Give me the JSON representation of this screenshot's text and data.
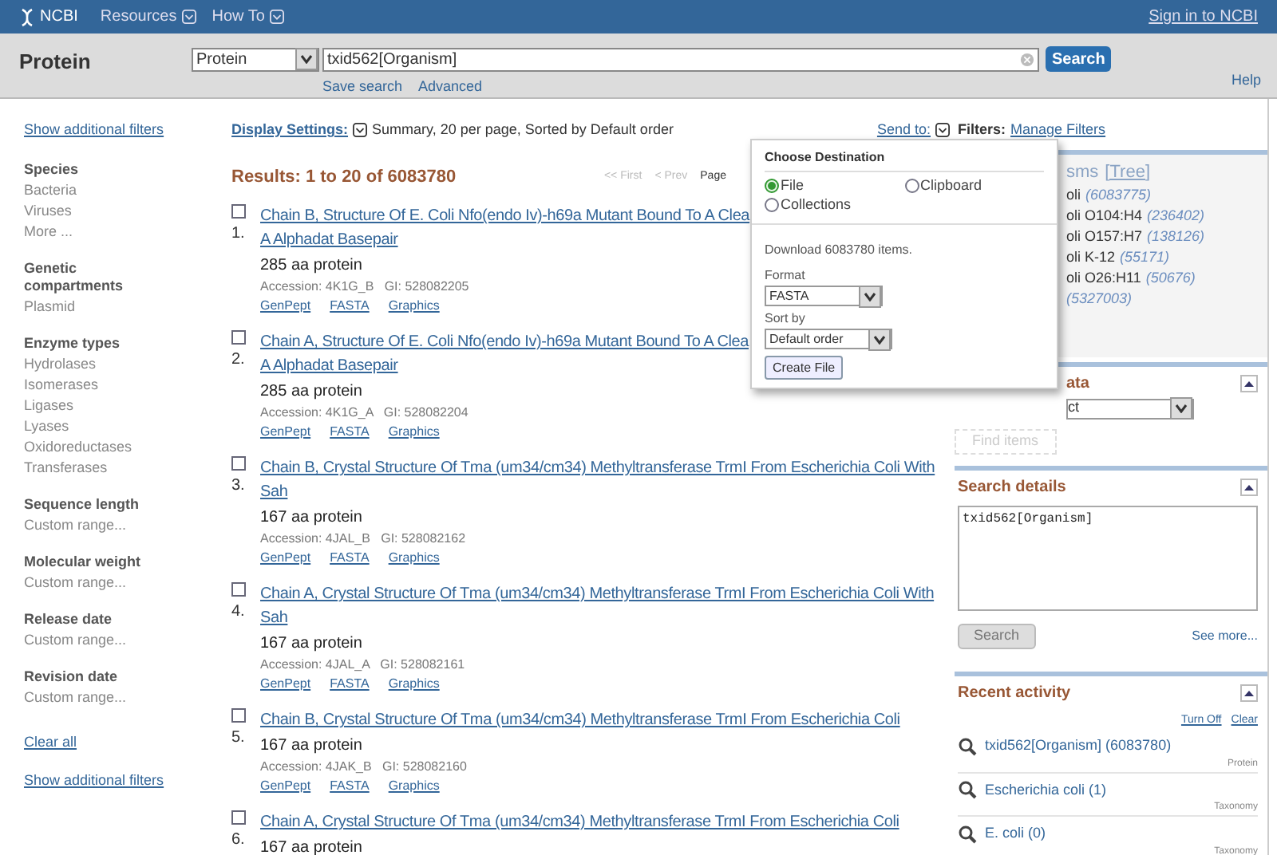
{
  "header": {
    "logo": "NCBI",
    "menus": [
      "Resources",
      "How To"
    ],
    "sign_in": "Sign in to NCBI"
  },
  "search_bar": {
    "title": "Protein",
    "database": "Protein",
    "query": "txid562[Organism]",
    "button": "Search",
    "links": [
      "Save search",
      "Advanced"
    ],
    "help": "Help"
  },
  "filters": {
    "show_link_top": "Show additional filters",
    "groups": [
      {
        "title": "Species",
        "items": [
          "Bacteria",
          "Viruses",
          "More ..."
        ]
      },
      {
        "title": "Genetic compartments",
        "items": [
          "Plasmid"
        ]
      },
      {
        "title": "Enzyme types",
        "items": [
          "Hydrolases",
          "Isomerases",
          "Ligases",
          "Lyases",
          "Oxidoreductases",
          "Transferases"
        ]
      },
      {
        "title": "Sequence length",
        "items": [
          "Custom range..."
        ]
      },
      {
        "title": "Molecular weight",
        "items": [
          "Custom range..."
        ]
      },
      {
        "title": "Release date",
        "items": [
          "Custom range..."
        ]
      },
      {
        "title": "Revision date",
        "items": [
          "Custom range..."
        ]
      }
    ],
    "clear": "Clear all",
    "show_link_bottom": "Show additional filters"
  },
  "toolbar": {
    "display_settings": "Display Settings:",
    "summary": "Summary, 20 per page, Sorted by Default order",
    "send_to": "Send to:",
    "filters_label": "Filters:",
    "manage_filters": "Manage Filters"
  },
  "results": {
    "heading": "Results: 1 to 20 of 6083780",
    "pager": [
      "<< First",
      "< Prev",
      "Page"
    ],
    "items": [
      {
        "number": "1.",
        "checked": false,
        "title_lines": [
          "Chain B, Structure Of E. Coli Nfo(endo Iv)-h69a Mutant Bound To A Clea",
          "A Alphadat Basepair"
        ],
        "length": "285 aa protein",
        "accession": "Accession: 4K1G_B   GI: 528082205",
        "links": [
          "GenPept",
          "FASTA",
          "Graphics"
        ]
      },
      {
        "number": "2.",
        "checked": false,
        "title_lines": [
          "Chain A, Structure Of E. Coli Nfo(endo Iv)-h69a Mutant Bound To A Clea",
          "A Alphadat Basepair"
        ],
        "length": "285 aa protein",
        "accession": "Accession: 4K1G_A   GI: 528082204",
        "links": [
          "GenPept",
          "FASTA",
          "Graphics"
        ]
      },
      {
        "number": "3.",
        "checked": false,
        "title_lines": [
          "Chain B, Crystal Structure Of Tma (um34/cm34) Methyltransferase TrmI From Escherichia Coli With",
          "Sah"
        ],
        "length": "167 aa protein",
        "accession": "Accession: 4JAL_B   GI: 528082162",
        "links": [
          "GenPept",
          "FASTA",
          "Graphics"
        ]
      },
      {
        "number": "4.",
        "checked": false,
        "title_lines": [
          "Chain A, Crystal Structure Of Tma (um34/cm34) Methyltransferase TrmI From Escherichia Coli With",
          "Sah"
        ],
        "length": "167 aa protein",
        "accession": "Accession: 4JAL_A   GI: 528082161",
        "links": [
          "GenPept",
          "FASTA",
          "Graphics"
        ]
      },
      {
        "number": "5.",
        "checked": false,
        "title_lines": [
          "Chain B, Crystal Structure Of Tma (um34/cm34) Methyltransferase TrmI From Escherichia Coli"
        ],
        "length": "167 aa protein",
        "accession": "Accession: 4JAK_B   GI: 528082160",
        "links": [
          "GenPept",
          "FASTA",
          "Graphics"
        ]
      },
      {
        "number": "6.",
        "checked": false,
        "title_lines": [
          "Chain A, Crystal Structure Of Tma (um34/cm34) Methyltransferase TrmI From Escherichia Coli"
        ],
        "length": "167 aa protein"
      }
    ]
  },
  "send_popup": {
    "title": "Choose Destination",
    "options": [
      {
        "label": "File",
        "selected": true
      },
      {
        "label": "Clipboard",
        "selected": false
      },
      {
        "label": "Collections",
        "selected": false
      }
    ],
    "download": "Download 6083780 items.",
    "format_label": "Format",
    "format_value": "FASTA",
    "sort_label": "Sort by",
    "sort_value": "Default order",
    "button": "Create File"
  },
  "sidebar": {
    "organisms": {
      "title_fragment": "sms",
      "tree": "[Tree]",
      "rows": [
        {
          "name": "oli",
          "count": "(6083775)"
        },
        {
          "name": "oli O104:H4",
          "count": "(236402)"
        },
        {
          "name": "oli O157:H7",
          "count": "(138126)"
        },
        {
          "name": "oli K-12",
          "count": "(55171)"
        },
        {
          "name": "oli O26:H11",
          "count": "(50676)"
        },
        {
          "count": "(5327003)"
        }
      ]
    },
    "related": {
      "title_fragment": "ata",
      "select_fragment": "ct",
      "button": "Find items"
    },
    "search_details": {
      "title": "Search details",
      "query": "txid562[Organism]",
      "button": "Search",
      "see_more": "See more..."
    },
    "recent": {
      "title": "Recent activity",
      "links": [
        "Turn Off",
        "Clear"
      ],
      "items": [
        {
          "text": "txid562[Organism] (6083780)",
          "category": "Protein"
        },
        {
          "text": "Escherichia coli (1)",
          "category": "Taxonomy"
        },
        {
          "text": "E. coli (0)",
          "category": "Taxonomy"
        }
      ]
    }
  }
}
